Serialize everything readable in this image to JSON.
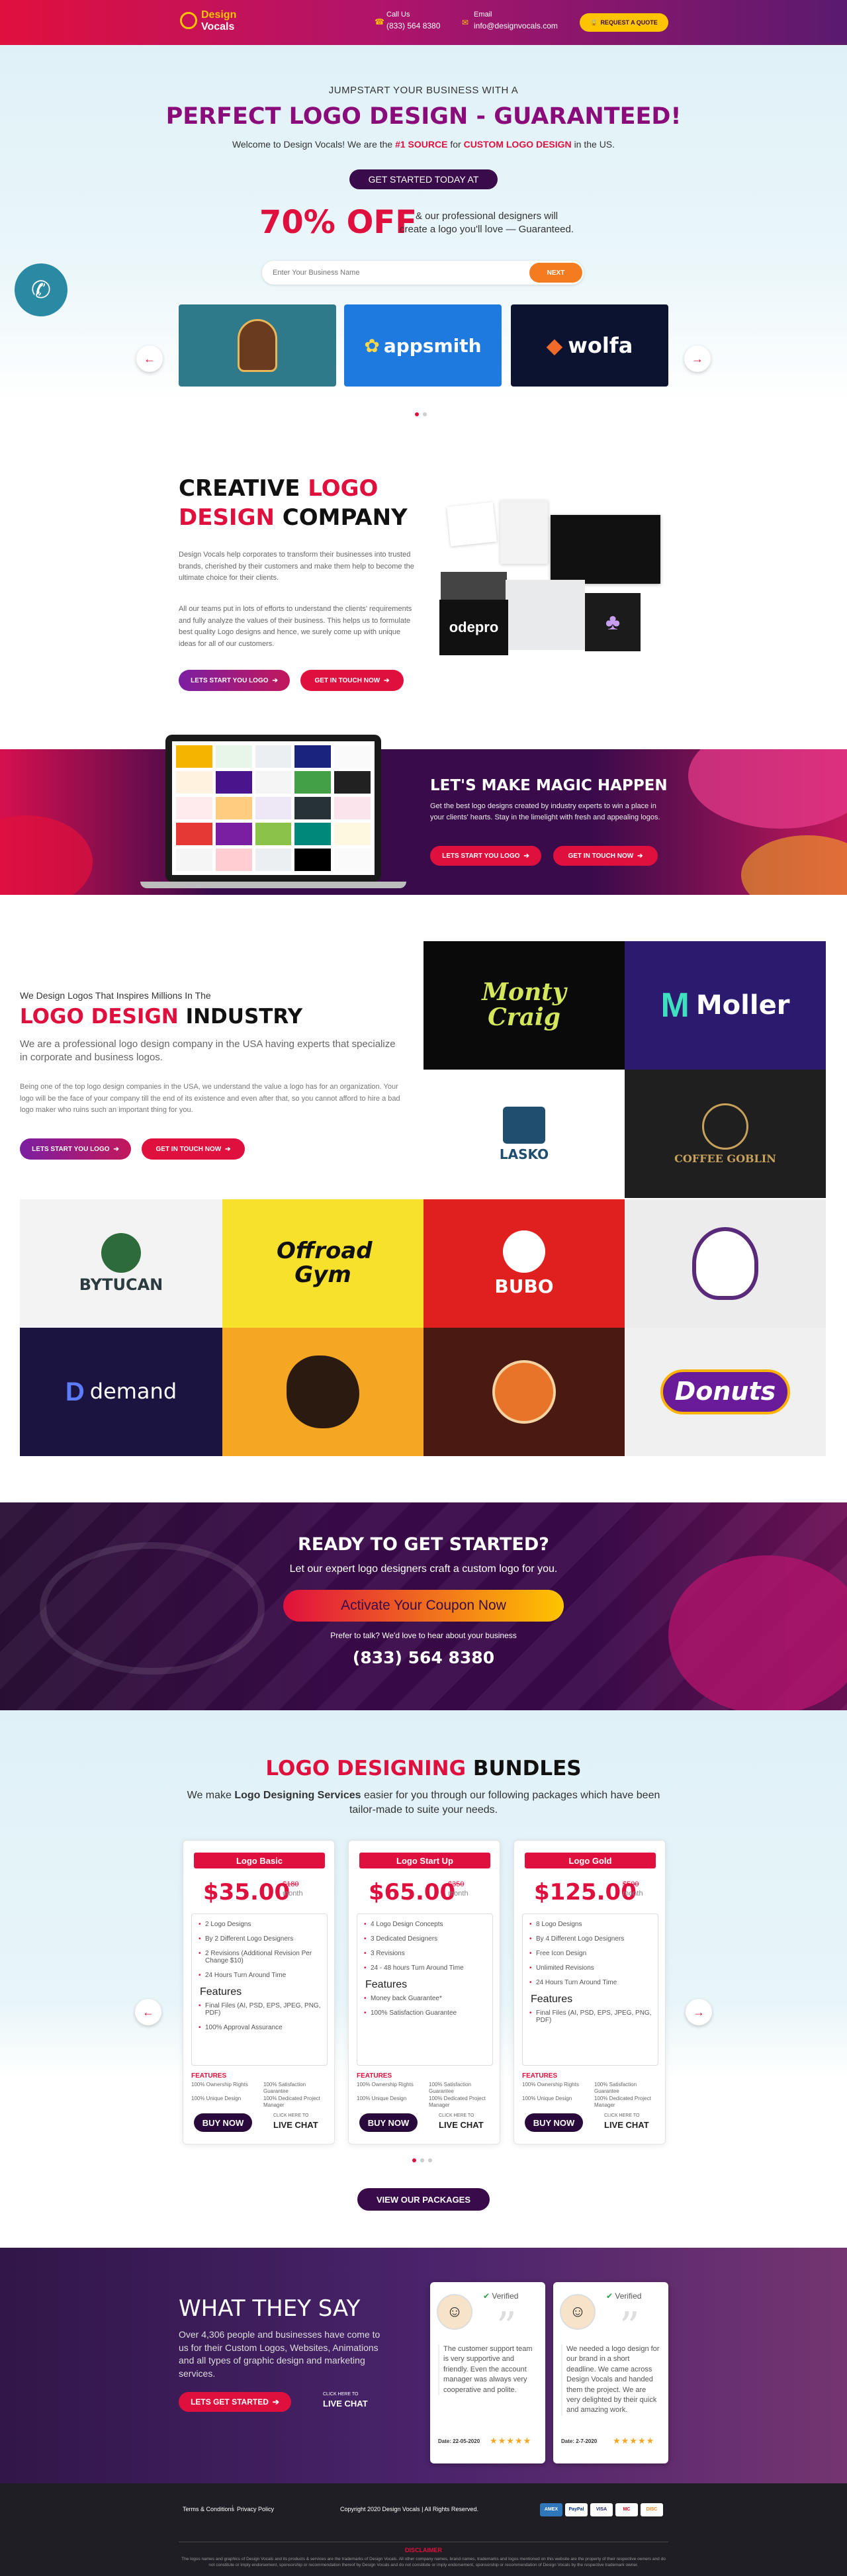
{
  "header": {
    "logo_top": "Design",
    "logo_bottom": "Vocals",
    "call_label": "Call Us",
    "phone": "(833) 564 8380",
    "email_label": "Email",
    "email": "info@designvocals.com",
    "quote_button": "REQUEST A QUOTE"
  },
  "hero": {
    "kicker": "JUMPSTART YOUR BUSINESS WITH A",
    "title": "PERFECT LOGO DESIGN - GUARANTEED!",
    "welcome_pre": "Welcome to Design Vocals! We are the",
    "welcome_source": "#1 SOURCE",
    "welcome_mid": "for",
    "welcome_custom": "CUSTOM LOGO DESIGN",
    "welcome_post": "in the US.",
    "cta": "GET STARTED TODAY AT",
    "offer_big": "70% OFF",
    "offer_text_1": "& our professional designers will",
    "offer_text_2": "create a logo you'll love — Guaranteed.",
    "input_placeholder": "Enter Your Business Name",
    "next_button": "NEXT",
    "slides": [
      "",
      "appsmith",
      "wolfa"
    ]
  },
  "creative": {
    "title_1": "CREATIVE",
    "title_2": "LOGO",
    "title_3": "DESIGN",
    "title_4": "COMPANY",
    "para_1": "Design Vocals help corporates to transform their businesses into trusted brands, cherished by their customers and make them help to become the ultimate choice for their clients.",
    "para_2": "All our teams put in lots of efforts to understand the clients' requirements and fully analyze the values of their business. This helps us to formulate best quality Logo designs and hence, we surely come up with unique ideas for all of our customers.",
    "btn_start": "LETS START YOU LOGO",
    "btn_touch": "GET IN TOUCH NOW",
    "collage_word": "odepro"
  },
  "magic": {
    "title": "LET'S MAKE MAGIC HAPPEN",
    "text": "Get the best logo designs created by industry experts to win a place in your clients' hearts. Stay in the limelight with fresh and appealing logos.",
    "btn_start": "LETS START YOU LOGO",
    "btn_touch": "GET IN TOUCH NOW"
  },
  "industry": {
    "kicker": "We Design Logos That Inspires Millions In The",
    "title_red": "LOGO DESIGN",
    "title_dark": "INDUSTRY",
    "sub": "We are a professional logo design company in the USA having experts that specialize in corporate and business logos.",
    "para": "Being one of the top logo design companies in the USA, we understand the value a logo has for an organization. Your logo will be the face of your company till the end of its existence and even after that, so you cannot afford to hire a bad logo maker who ruins such an important thing for you.",
    "btn_start": "LETS START YOU LOGO",
    "btn_touch": "GET IN TOUCH NOW",
    "tiles": [
      "Monty Craig",
      "Moller",
      "LASKO",
      "COFFEE GOBLIN",
      "BYTUCAN",
      "Offroad Gym",
      "BUBO",
      "",
      "demand",
      "",
      "",
      "Donuts"
    ]
  },
  "ready": {
    "title": "READY TO GET STARTED?",
    "sub": "Let our expert logo designers craft a custom logo for you.",
    "coupon": "Activate Your Coupon Now",
    "talk": "Prefer to talk? We'd love to hear about your business",
    "phone": "(833) 564 8380"
  },
  "bundles": {
    "title_red": "LOGO DESIGNING",
    "title_dark": "BUNDLES",
    "sub_pre": "We make",
    "sub_bold": "Logo Designing Services",
    "sub_post": "easier for you through our following packages which have been tailor-made to suite your needs.",
    "features_label": "FEATURES",
    "buy_label": "BUY NOW",
    "click_label": "CLICK HERE TO",
    "live_label": "LIVE CHAT",
    "features_heading": "Features",
    "packages": [
      {
        "name": "Logo Basic",
        "price": "$35.00",
        "old": "$180",
        "per": "month",
        "items": [
          "2 Logo Designs",
          "By 2 Different Logo Designers",
          "2 Revisions (Additional Revision Per Change $10)",
          "24 Hours Turn Around Time"
        ],
        "features": [
          "Final Files (AI, PSD, EPS, JPEG, PNG, PDF)",
          "100% Approval Assurance"
        ],
        "bottom": [
          "100% Ownership Rights",
          "100% Satisfaction Guarantee",
          "100% Unique Design",
          "100% Dedicated Project Manager"
        ]
      },
      {
        "name": "Logo Start Up",
        "price": "$65.00",
        "old": "$350",
        "per": "month",
        "items": [
          "4 Logo Design Concepts",
          "3 Dedicated Designers",
          "3 Revisions",
          "24 - 48 hours Turn Around Time"
        ],
        "features": [
          "Money back Guarantee*",
          "100% Satisfaction Guarantee"
        ],
        "bottom": [
          "100% Ownership Rights",
          "100% Satisfaction Guarantee",
          "100% Unique Design",
          "100% Dedicated Project Manager"
        ]
      },
      {
        "name": "Logo Gold",
        "price": "$125.00",
        "old": "$500",
        "per": "month",
        "items": [
          "8 Logo Designs",
          "By 4 Different Logo Designers",
          "Free Icon Design",
          "Unlimited Revisions",
          "24 Hours Turn Around Time"
        ],
        "features": [
          "Final Files (AI, PSD, EPS, JPEG, PNG, PDF)"
        ],
        "bottom": [
          "100% Ownership Rights",
          "100% Satisfaction Guarantee",
          "100% Unique Design",
          "100% Dedicated Project Manager"
        ]
      }
    ],
    "view_button": "VIEW OUR PACKAGES"
  },
  "testimonials": {
    "title": "WHAT THEY SAY",
    "text": "Over 4,306 people and businesses have come to us for their Custom Logos, Websites, Animations and all types of graphic design and marketing services.",
    "btn": "LETS GET STARTED",
    "click_label": "CLICK HERE TO",
    "live_label": "LIVE CHAT",
    "verified": "Verified",
    "reviews": [
      {
        "text": "The customer support team is very supportive and friendly. Even the account manager was always very cooperative and polite.",
        "date": "Date: 22-05-2020",
        "stars": "★★★★★"
      },
      {
        "text": "We needed a logo design for our brand in a short deadline. We came across Design Vocals and handed them the project. We are very delighted by their quick and amazing work.",
        "date": "Date: 2-7-2020",
        "stars": "★★★★★"
      }
    ]
  },
  "footer": {
    "terms": "Terms & Conditions",
    "privacy": "Privacy Policy",
    "copyright": "Copyright 2020 Design Vocals | All Rights Reserved.",
    "payments": [
      "AMEX",
      "PayPal",
      "VISA",
      "MC",
      "DISC"
    ],
    "disclaimer_title": "DISCLAIMER",
    "disclaimer": "The logos names and graphics of Design Vocals and its products & services are the trademarks of Design Vocals. All other company names, brand names, trademarks and logos mentioned on this website are the property of their respective owners and do not constitute or imply endorsement, sponsorship or recommendation thereof by Design Vocals and do not constitute or imply endorsement, sponsorship or recommendation of Design Vocals by the respective trademark owner."
  },
  "colors": {
    "brand_red": "#e0103e",
    "brand_purple": "#3a0b4a",
    "accent_yellow": "#ffc400"
  }
}
